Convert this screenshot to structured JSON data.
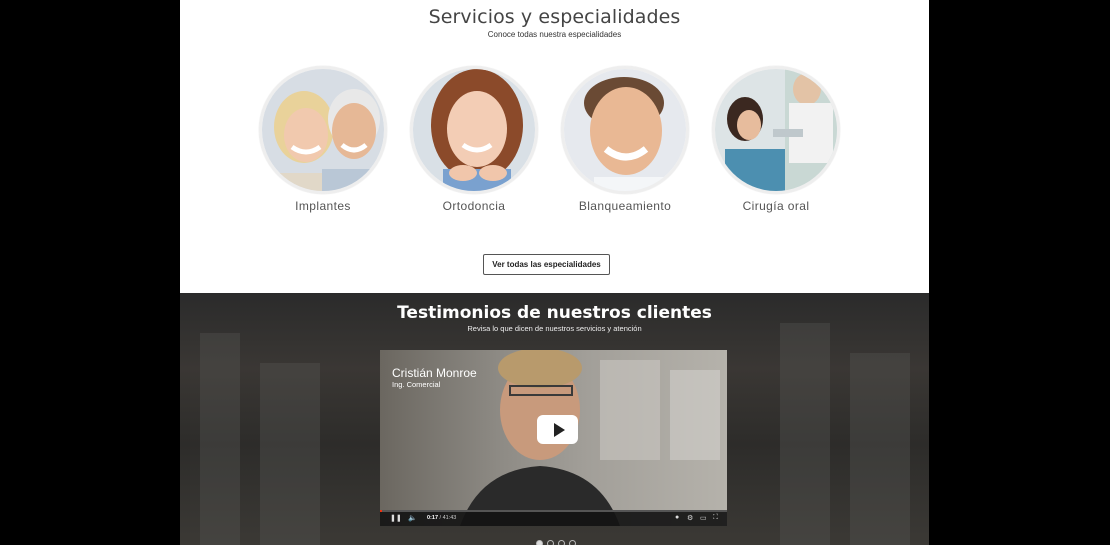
{
  "services": {
    "title": "Servicios y especialidades",
    "subtitle": "Conoce todas nuestra especialidades",
    "items": [
      {
        "label": "Implantes",
        "image": "older-couple-smiling"
      },
      {
        "label": "Ortodoncia",
        "image": "girl-with-braces-smiling"
      },
      {
        "label": "Blanqueamiento",
        "image": "man-smiling"
      },
      {
        "label": "Cirugía oral",
        "image": "patient-in-dental-chair"
      }
    ],
    "button_label": "Ver todas las especialidades"
  },
  "testimonials": {
    "title": "Testimonios de nuestros clientes",
    "subtitle": "Revisa lo que dicen de nuestros servicios y atención",
    "video": {
      "name": "Cristián Monroe",
      "role": "Ing. Comercial",
      "current_time": "0:17",
      "duration": "/ 41:43",
      "progress": 0.007
    },
    "carousel": {
      "count": 4,
      "active_index": 0
    }
  },
  "colors": {
    "accent": "#e31e24",
    "background": "#000000"
  }
}
